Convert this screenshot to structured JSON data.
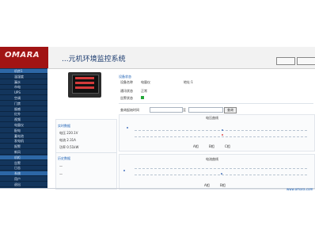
{
  "header": {
    "logo_text": "OMARA",
    "app_title": "...元机环境监控系统",
    "buttons": [
      "",
      ""
    ]
  },
  "sidebar": {
    "items": [
      {
        "label": "机房1",
        "active": true
      },
      {
        "label": "温湿度",
        "active": false
      },
      {
        "label": "漏水",
        "active": false
      },
      {
        "label": "市电",
        "active": false
      },
      {
        "label": "UPS",
        "active": false
      },
      {
        "label": "空调",
        "active": false
      },
      {
        "label": "门禁",
        "active": false
      },
      {
        "label": "烟感",
        "active": false
      },
      {
        "label": "红外",
        "active": false
      },
      {
        "label": "视频",
        "active": false
      },
      {
        "label": "电量仪",
        "active": false
      },
      {
        "label": "配电",
        "active": false
      },
      {
        "label": "蓄电池",
        "active": false
      },
      {
        "label": "发电机",
        "active": false
      },
      {
        "label": "报警",
        "active": false
      },
      {
        "label": "新风",
        "active": false
      },
      {
        "label": "机柜",
        "active": true
      },
      {
        "label": "告警",
        "active": false
      },
      {
        "label": "日志",
        "active": false
      },
      {
        "label": "系统",
        "active": true
      },
      {
        "label": "用户",
        "active": false
      },
      {
        "label": "退出",
        "active": false
      }
    ]
  },
  "device_info": {
    "section_title": "设备状态",
    "rows": [
      {
        "label": "设备名称",
        "value": "电量仪",
        "extra": "地址:1"
      },
      {
        "label": "通讯状态",
        "value": "正常"
      },
      {
        "label": "告警状态",
        "value": ""
      }
    ]
  },
  "left_panel": {
    "title1": "实时数据",
    "items1": [
      "电压 220.1V",
      "电流 2.31A",
      "功率 0.51kW"
    ],
    "title2": "历史数据",
    "items2": [
      "—",
      "—"
    ]
  },
  "query": {
    "label_start": "查询起始时间",
    "label_end": "至",
    "button": "查询"
  },
  "chart1": {
    "title": "电压曲线",
    "subtitle": "",
    "legend": [
      "A相",
      "B相",
      "C相"
    ]
  },
  "chart2": {
    "title": "电流曲线",
    "subtitle": "",
    "legend": [
      "A相",
      "B相"
    ]
  },
  "footer_link": "www.omara.com"
}
